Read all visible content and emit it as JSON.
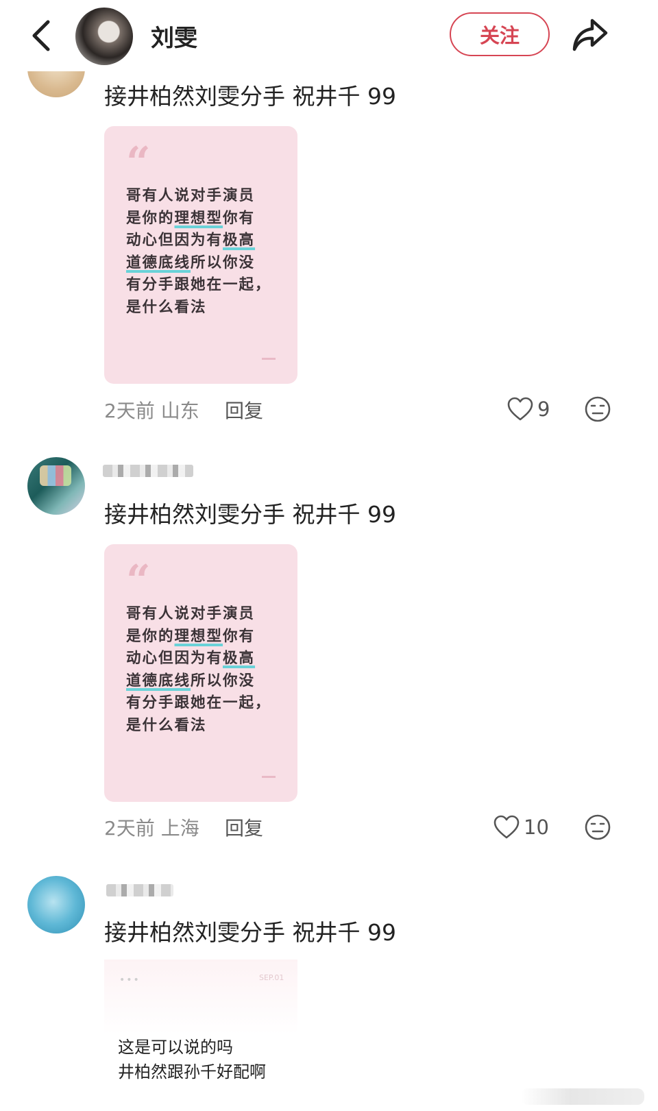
{
  "header": {
    "title": "刘雯",
    "follow_label": "关注"
  },
  "comments": [
    {
      "text": "接井柏然刘雯分手 祝井千 99",
      "card": {
        "lines": [
          "哥有人说对手演员",
          "是你的理想型你有",
          "动心但因为有极高",
          "道德底线所以你没",
          "有分手跟她在一起，",
          "是什么看法"
        ]
      },
      "time": "2天前",
      "location": "山东",
      "reply_label": "回复",
      "likes": "9"
    },
    {
      "text": "接井柏然刘雯分手 祝井千 99",
      "card": {
        "lines": [
          "哥有人说对手演员",
          "是你的理想型你有",
          "动心但因为有极高",
          "道德底线所以你没",
          "有分手跟她在一起，",
          "是什么看法"
        ]
      },
      "time": "2天前",
      "location": "上海",
      "reply_label": "回复",
      "likes": "10"
    },
    {
      "text": "接井柏然刘雯分手 祝井千 99",
      "image_card": {
        "corner_text": "SEP.01",
        "lines": [
          "这是可以说的吗",
          "井柏然跟孙千好配啊"
        ]
      }
    }
  ],
  "colors": {
    "accent": "#d64553",
    "card_bg": "#f8dfe6",
    "highlight": "#69d2d8"
  }
}
